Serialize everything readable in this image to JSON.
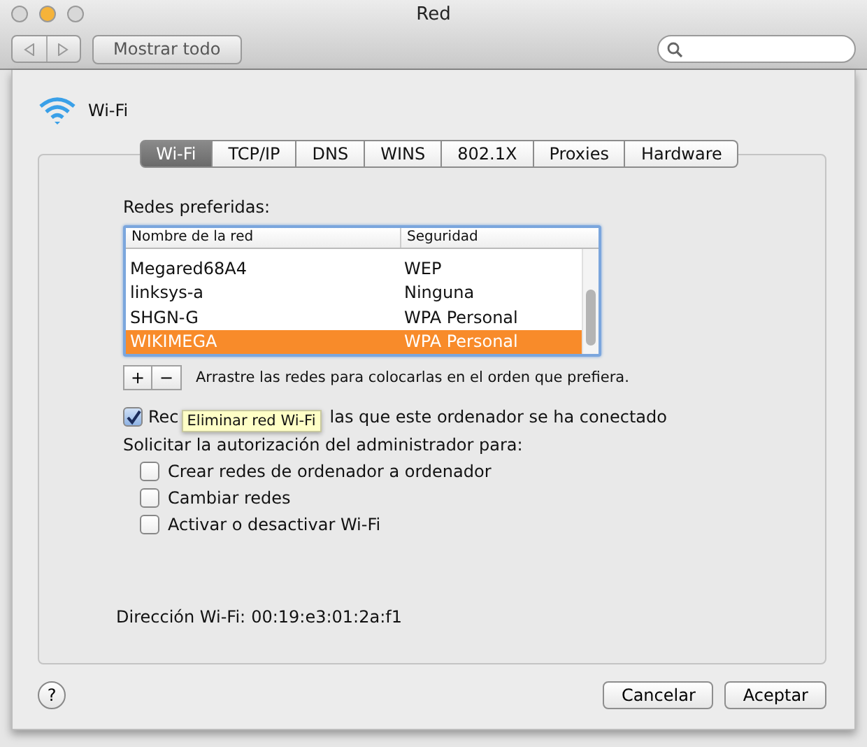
{
  "window": {
    "title": "Red"
  },
  "toolbar": {
    "show_all": "Mostrar todo"
  },
  "sheet": {
    "service": "Wi-Fi",
    "tabs": [
      {
        "label": "Wi-Fi",
        "selected": true
      },
      {
        "label": "TCP/IP",
        "selected": false
      },
      {
        "label": "DNS",
        "selected": false
      },
      {
        "label": "WINS",
        "selected": false
      },
      {
        "label": "802.1X",
        "selected": false
      },
      {
        "label": "Proxies",
        "selected": false
      },
      {
        "label": "Hardware",
        "selected": false
      }
    ],
    "preferred_label": "Redes preferidas:",
    "table": {
      "columns": [
        "Nombre de la red",
        "Seguridad"
      ],
      "rows": [
        {
          "name": "Megared68A4",
          "security": "WEP",
          "selected": false
        },
        {
          "name": "linksys-a",
          "security": "Ninguna",
          "selected": false
        },
        {
          "name": "SHGN-G",
          "security": "WPA Personal",
          "selected": false
        },
        {
          "name": "WIKIMEGA",
          "security": "WPA Personal",
          "selected": true
        }
      ]
    },
    "add": "+",
    "remove": "−",
    "drag_hint": "Arrastre las redes para colocarlas en el orden que prefiera.",
    "remember": {
      "checked": true,
      "label_start": "Rec",
      "label_end": "las que este ordenador se ha conectado"
    },
    "tooltip": "Eliminar red Wi-Fi",
    "admin_label": "Solicitar la autorización del administrador para:",
    "admin_options": [
      {
        "label": "Crear redes de ordenador a ordenador",
        "checked": false
      },
      {
        "label": "Cambiar redes",
        "checked": false
      },
      {
        "label": "Activar o desactivar Wi-Fi",
        "checked": false
      }
    ],
    "address_label": "Dirección Wi-Fi:",
    "address": "00:19:e3:01:2a:f1",
    "help": "?",
    "buttons": [
      {
        "label": "Cancelar",
        "default": false
      },
      {
        "label": "Aceptar",
        "default": false
      }
    ]
  }
}
